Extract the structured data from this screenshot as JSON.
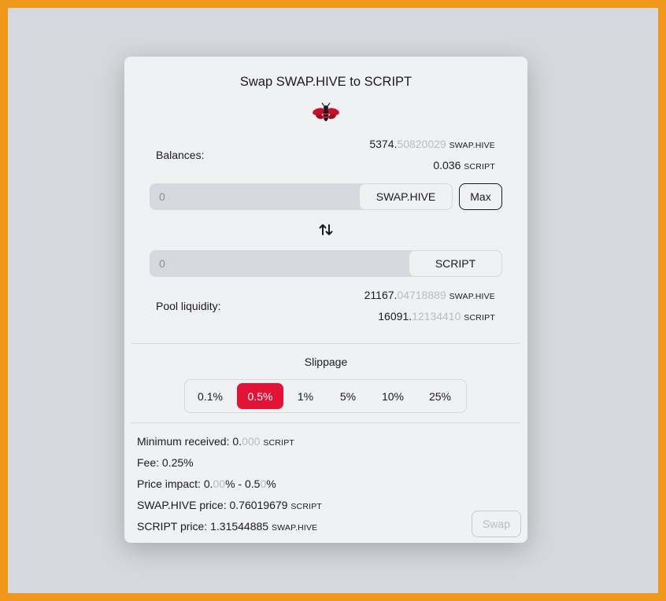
{
  "modal": {
    "title": "Swap SWAP.HIVE to SCRIPT",
    "logo_icon": "hive-bee-icon"
  },
  "balances": {
    "label": "Balances:",
    "from": {
      "whole": "5374.",
      "decimals": "50820029",
      "unit": "SWAP.HIVE"
    },
    "to": {
      "whole": "0.036",
      "decimals": "",
      "unit": "SCRIPT"
    }
  },
  "from_input": {
    "value": "0",
    "token": "SWAP.HIVE"
  },
  "max_label": "Max",
  "to_input": {
    "value": "0",
    "token": "SCRIPT"
  },
  "pool": {
    "label": "Pool liquidity:",
    "a": {
      "whole": "21167.",
      "decimals": "04718889",
      "unit": "SWAP.HIVE"
    },
    "b": {
      "whole": "16091.",
      "decimals": "12134410",
      "unit": "SCRIPT"
    }
  },
  "slippage": {
    "title": "Slippage",
    "options": [
      "0.1%",
      "0.5%",
      "1%",
      "5%",
      "10%",
      "25%"
    ],
    "selected": "0.5%"
  },
  "details": {
    "min_received": {
      "label": "Minimum received: ",
      "whole": "0.",
      "decimals": "000",
      "unit": "SCRIPT"
    },
    "fee": {
      "text": "Fee: 0.25%"
    },
    "price_impact": {
      "label": "Price impact: ",
      "p1a": "0.",
      "p1b": "00",
      "p1c": "%",
      "sep": " - ",
      "p2a": "0.5",
      "p2b": "0",
      "p2c": "%"
    },
    "from_price": {
      "label": "SWAP.HIVE price: ",
      "value": "0.76019679",
      "unit": "SCRIPT"
    },
    "to_price": {
      "label": "SCRIPT price: ",
      "value": "1.31544885",
      "unit": "SWAP.HIVE"
    }
  },
  "swap_label": "Swap",
  "colors": {
    "accent": "#e31337",
    "frame": "#f0981c"
  }
}
